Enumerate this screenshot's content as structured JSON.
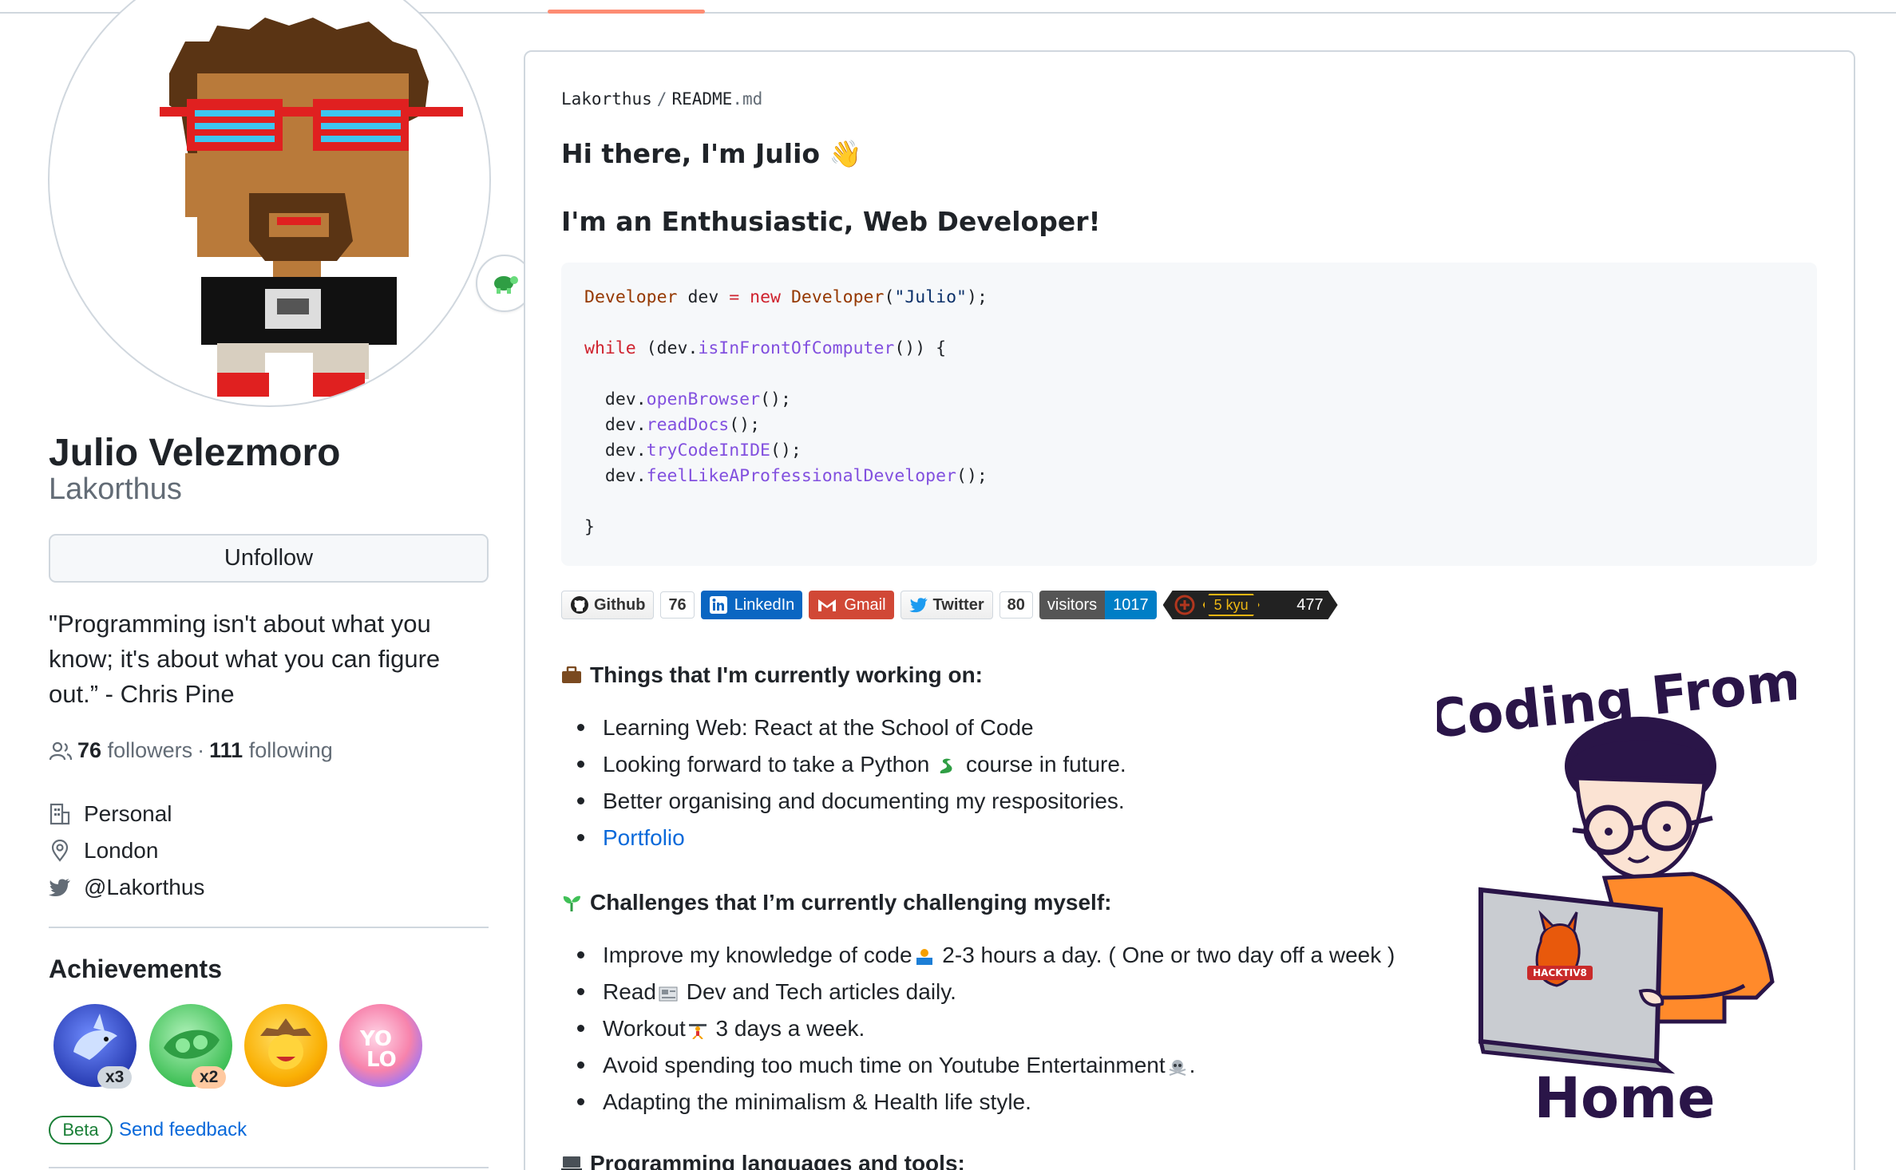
{
  "profile": {
    "full_name": "Julio Velezmoro",
    "login": "Lakorthus",
    "unfollow_label": "Unfollow",
    "bio": "\"Programming isn't about what you know; it's about what you can figure out.” - Chris Pine",
    "followers_count": "76",
    "followers_label": "followers",
    "separator": "·",
    "following_count": "111",
    "following_label": "following",
    "details": [
      {
        "icon": "organization-icon",
        "text": "Personal"
      },
      {
        "icon": "location-icon",
        "text": "London"
      },
      {
        "icon": "twitter-icon",
        "text": "@Lakorthus"
      }
    ],
    "achievements_title": "Achievements",
    "achievements": [
      {
        "name": "shark",
        "count": "x3",
        "color": "#3b5bdb"
      },
      {
        "name": "pair-extraordinaire",
        "count": "x2",
        "color": "#2fb344"
      },
      {
        "name": "quickdraw",
        "count": "",
        "color": "#f59f00"
      },
      {
        "name": "yolo",
        "count": "",
        "color": "#e64980"
      }
    ],
    "beta_label": "Beta",
    "feedback_label": "Send feedback"
  },
  "readme": {
    "path_owner": "Lakorthus",
    "path_sep": "/",
    "path_file": "README",
    "path_ext": ".md",
    "greeting": "Hi there, I'm Julio 👋",
    "subtitle": "I'm an Enthusiastic, Web Developer!",
    "code": {
      "l1_type": "Developer",
      "l1_var": " dev ",
      "l1_eq": "=",
      "l1_new": "new",
      "l1_type2": "Developer",
      "l1_str": "\"Julio\"",
      "l1_end": ");",
      "l3_kw": "while",
      "l3_a": " (dev.",
      "l3_fn": "isInFrontOfComputer",
      "l3_b": "()) {",
      "m1": "openBrowser",
      "m2": "readDocs",
      "m3": "tryCodeInIDE",
      "m4": "feelLikeAProfessionalDeveloper",
      "close": "}"
    },
    "shields": {
      "github": "Github",
      "github_count": "76",
      "linkedin": "LinkedIn",
      "gmail": "Gmail",
      "twitter": "Twitter",
      "twitter_count": "80",
      "visitors_label": "visitors",
      "visitors_count": "1017",
      "codewars_rank": "5 kyu",
      "codewars_score": "477"
    },
    "working_title": "Things that I'm currently working on:",
    "working": [
      "Learning Web: React at the School of Code",
      "Looking forward to take a Python",
      "course in future.",
      "Better organising and documenting my respositories.",
      "Portfolio"
    ],
    "challenges_title": "Challenges that I’m currently challenging myself:",
    "challenges": {
      "c1a": "Improve my knowledge of code",
      "c1b": " 2-3 hours a day. ( One or two day off a week )",
      "c2a": "Read",
      "c2b": " Dev and Tech articles daily.",
      "c3a": "Workout",
      "c3b": " 3 days a week.",
      "c4a": "Avoid spending too much time on Youtube Entertainment",
      "c4b": ".",
      "c5": "Adapting the minimalism & Health life style."
    },
    "languages_title": "Programming languages and tools:",
    "illustration_text_top": "Coding From",
    "illustration_text_bottom": "Home",
    "laptop_sticker": "HACKTIV8"
  },
  "colors": {
    "accent": "#fd8c73",
    "link": "#0969da",
    "border": "#d0d7de"
  }
}
